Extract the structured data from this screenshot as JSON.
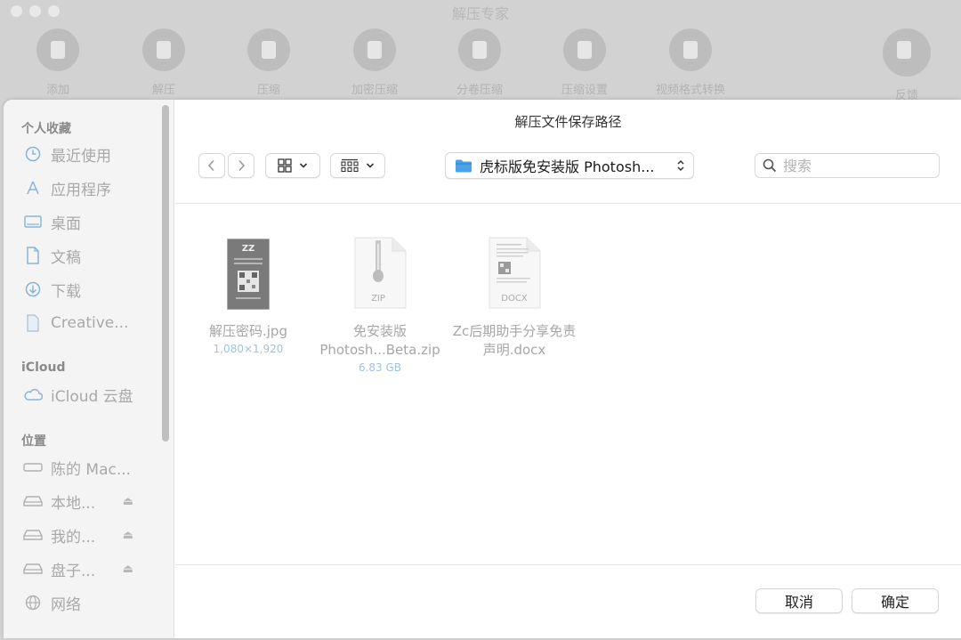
{
  "app": {
    "title": "解压专家",
    "tools": [
      {
        "label": "添加",
        "icon": "add-icon"
      },
      {
        "label": "解压",
        "icon": "extract-icon"
      },
      {
        "label": "压缩",
        "icon": "compress-icon"
      },
      {
        "label": "加密压缩",
        "icon": "encrypt-icon"
      },
      {
        "label": "分卷压缩",
        "icon": "split-icon"
      },
      {
        "label": "压缩设置",
        "icon": "settings-icon"
      },
      {
        "label": "视频格式转换",
        "icon": "video-icon"
      },
      {
        "label": "反馈",
        "icon": "feedback-icon"
      }
    ]
  },
  "dialog": {
    "title": "解压文件保存路径",
    "path": "虎标版免安装版 Photosh...",
    "search_placeholder": "搜索",
    "cancel_label": "取消",
    "confirm_label": "确定"
  },
  "sidebar": {
    "favorites_title": "个人收藏",
    "favorites": [
      {
        "label": "最近使用",
        "icon": "clock-icon"
      },
      {
        "label": "应用程序",
        "icon": "apps-icon"
      },
      {
        "label": "桌面",
        "icon": "desktop-icon"
      },
      {
        "label": "文稿",
        "icon": "document-icon"
      },
      {
        "label": "下载",
        "icon": "download-icon"
      },
      {
        "label": "Creative...",
        "icon": "file-icon"
      }
    ],
    "icloud_title": "iCloud",
    "icloud": [
      {
        "label": "iCloud 云盘",
        "icon": "cloud-icon"
      }
    ],
    "locations_title": "位置",
    "locations": [
      {
        "label": "陈的 Mac...",
        "icon": "laptop-icon",
        "eject": false
      },
      {
        "label": "本地...",
        "icon": "disk-icon",
        "eject": true
      },
      {
        "label": "我的...",
        "icon": "disk-icon",
        "eject": true
      },
      {
        "label": "盘子...",
        "icon": "disk-icon",
        "eject": true
      },
      {
        "label": "网络",
        "icon": "network-icon",
        "eject": false
      }
    ]
  },
  "files": [
    {
      "name": "解压密码.jpg",
      "meta": "1,080×1,920",
      "type": "image"
    },
    {
      "name": "免安装版 Photosh...Beta.zip",
      "meta": "6.83 GB",
      "type": "zip",
      "badge": "ZIP"
    },
    {
      "name": "Zc后期助手分享免责声明.docx",
      "meta": "",
      "type": "docx",
      "badge": "DOCX"
    }
  ]
}
